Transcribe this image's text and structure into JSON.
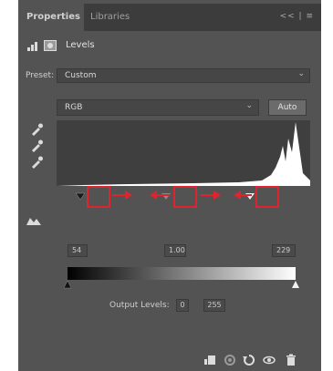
{
  "tabs": [
    {
      "label": "Properties",
      "active": true
    },
    {
      "label": "Libraries",
      "active": false
    }
  ],
  "tabbar_right": "<< | ≡",
  "header": {
    "title": "Levels"
  },
  "preset": {
    "label": "Preset:",
    "value": "Custom"
  },
  "channel": {
    "value": "RGB"
  },
  "auto_button": "Auto",
  "input_levels": {
    "black": "54",
    "gamma": "1.00",
    "white": "229"
  },
  "output_levels": {
    "label": "Output Levels:",
    "black": "0",
    "white": "255"
  },
  "colors": {
    "panel": "#535353",
    "tabbar": "#3c3c3c",
    "histogram_bg": "#3f3f3f",
    "highlight": "#e0242d"
  },
  "icons": [
    "adjustment-icon",
    "mask-icon",
    "eyedropper-black-icon",
    "eyedropper-gray-icon",
    "eyedropper-white-icon",
    "clipping-icon",
    "clip-to-layer-icon",
    "view-previous-icon",
    "reset-icon",
    "visibility-icon",
    "trash-icon"
  ]
}
